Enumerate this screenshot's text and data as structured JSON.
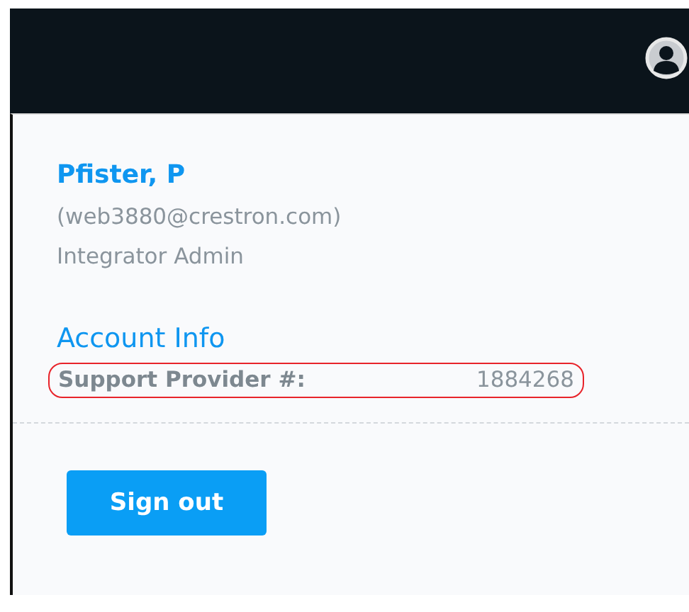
{
  "user": {
    "name": "Pfister, P",
    "email": "(web3880@crestron.com)",
    "role": "Integrator Admin"
  },
  "account_info": {
    "heading": "Account Info",
    "label": "Support Provider #:",
    "value": "1884268",
    "highlighted": true
  },
  "buttons": [
    "Sign out"
  ]
}
